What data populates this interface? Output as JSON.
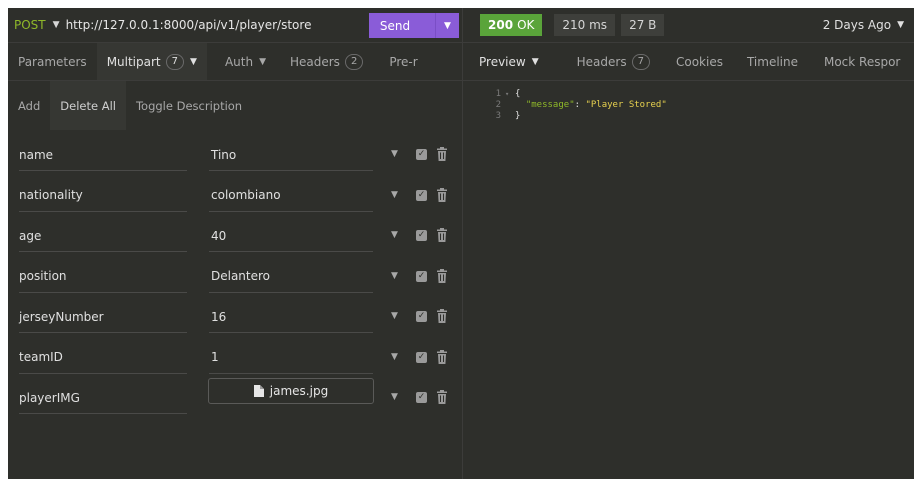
{
  "request": {
    "method": "POST",
    "url": "http://127.0.0.1:8000/api/v1/player/store",
    "send_label": "Send"
  },
  "request_tabs": [
    {
      "label": "Parameters",
      "badge": null,
      "caret": false
    },
    {
      "label": "Multipart",
      "badge": "7",
      "caret": true
    },
    {
      "label": "Auth",
      "badge": null,
      "caret": true
    },
    {
      "label": "Headers",
      "badge": "2",
      "caret": false
    },
    {
      "label": "Pre-r",
      "badge": null,
      "caret": false
    }
  ],
  "toolbar": {
    "add": "Add",
    "delete_all": "Delete All",
    "toggle_description": "Toggle Description"
  },
  "params": [
    {
      "name": "name",
      "value": "Tino",
      "type": "text"
    },
    {
      "name": "nationality",
      "value": "colombiano",
      "type": "text"
    },
    {
      "name": "age",
      "value": "40",
      "type": "text"
    },
    {
      "name": "position",
      "value": "Delantero",
      "type": "text"
    },
    {
      "name": "jerseyNumber",
      "value": "16",
      "type": "text"
    },
    {
      "name": "teamID",
      "value": "1",
      "type": "text"
    },
    {
      "name": "playerIMG",
      "value": "james.jpg",
      "type": "file"
    }
  ],
  "response": {
    "status_code": "200",
    "status_text": "OK",
    "time": "210 ms",
    "size": "27 B",
    "history": "2 Days Ago"
  },
  "response_tabs": [
    {
      "label": "Preview",
      "badge": null,
      "caret": true
    },
    {
      "label": "Headers",
      "badge": "7",
      "caret": false
    },
    {
      "label": "Cookies",
      "badge": null,
      "caret": false
    },
    {
      "label": "Timeline",
      "badge": null,
      "caret": false
    },
    {
      "label": "Mock Respor",
      "badge": null,
      "caret": false
    }
  ],
  "response_body": {
    "lines": [
      {
        "num": "1",
        "fold": "▾",
        "open": "{",
        "key": "",
        "sep": "",
        "value": ""
      },
      {
        "num": "2",
        "fold": "",
        "open": "  ",
        "key": "\"message\"",
        "sep": ": ",
        "value": "\"Player Stored\""
      },
      {
        "num": "3",
        "fold": "",
        "open": "}",
        "key": "",
        "sep": "",
        "value": ""
      }
    ]
  },
  "colors": {
    "background": "#2e2f2b",
    "method": "#8fb829",
    "send_button": "#8a5cd8",
    "status_ok": "#5aa43a",
    "json_key": "#8fb829",
    "json_string": "#e8d24f"
  }
}
